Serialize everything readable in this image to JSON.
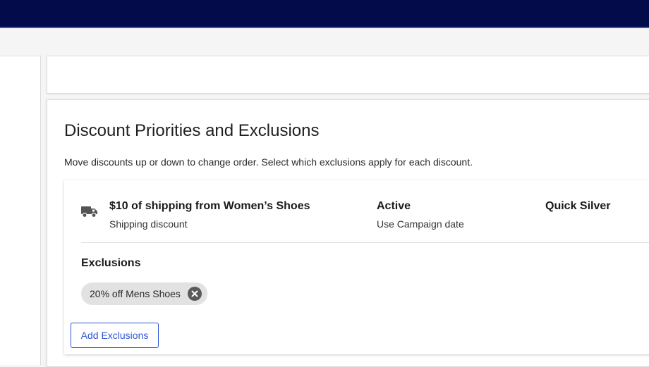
{
  "section": {
    "title": "Discount Priorities and Exclusions",
    "description": "Move discounts up or down to change order. Select which exclusions apply for each discount."
  },
  "discount": {
    "icon": "truck-icon",
    "name": "$10 of shipping from Women’s Shoes",
    "type": "Shipping discount",
    "status": "Active",
    "date": "Use Campaign date",
    "campaign": "Quick Silver"
  },
  "exclusions": {
    "heading": "Exclusions",
    "chips": [
      {
        "label": "20% off Mens Shoes",
        "remove_icon": "close-circle-icon"
      }
    ],
    "add_label": "Add Exclusions"
  },
  "colors": {
    "topbar": "#040b4a",
    "accent": "#2f56d6",
    "chip_bg": "#e2e2e2"
  }
}
